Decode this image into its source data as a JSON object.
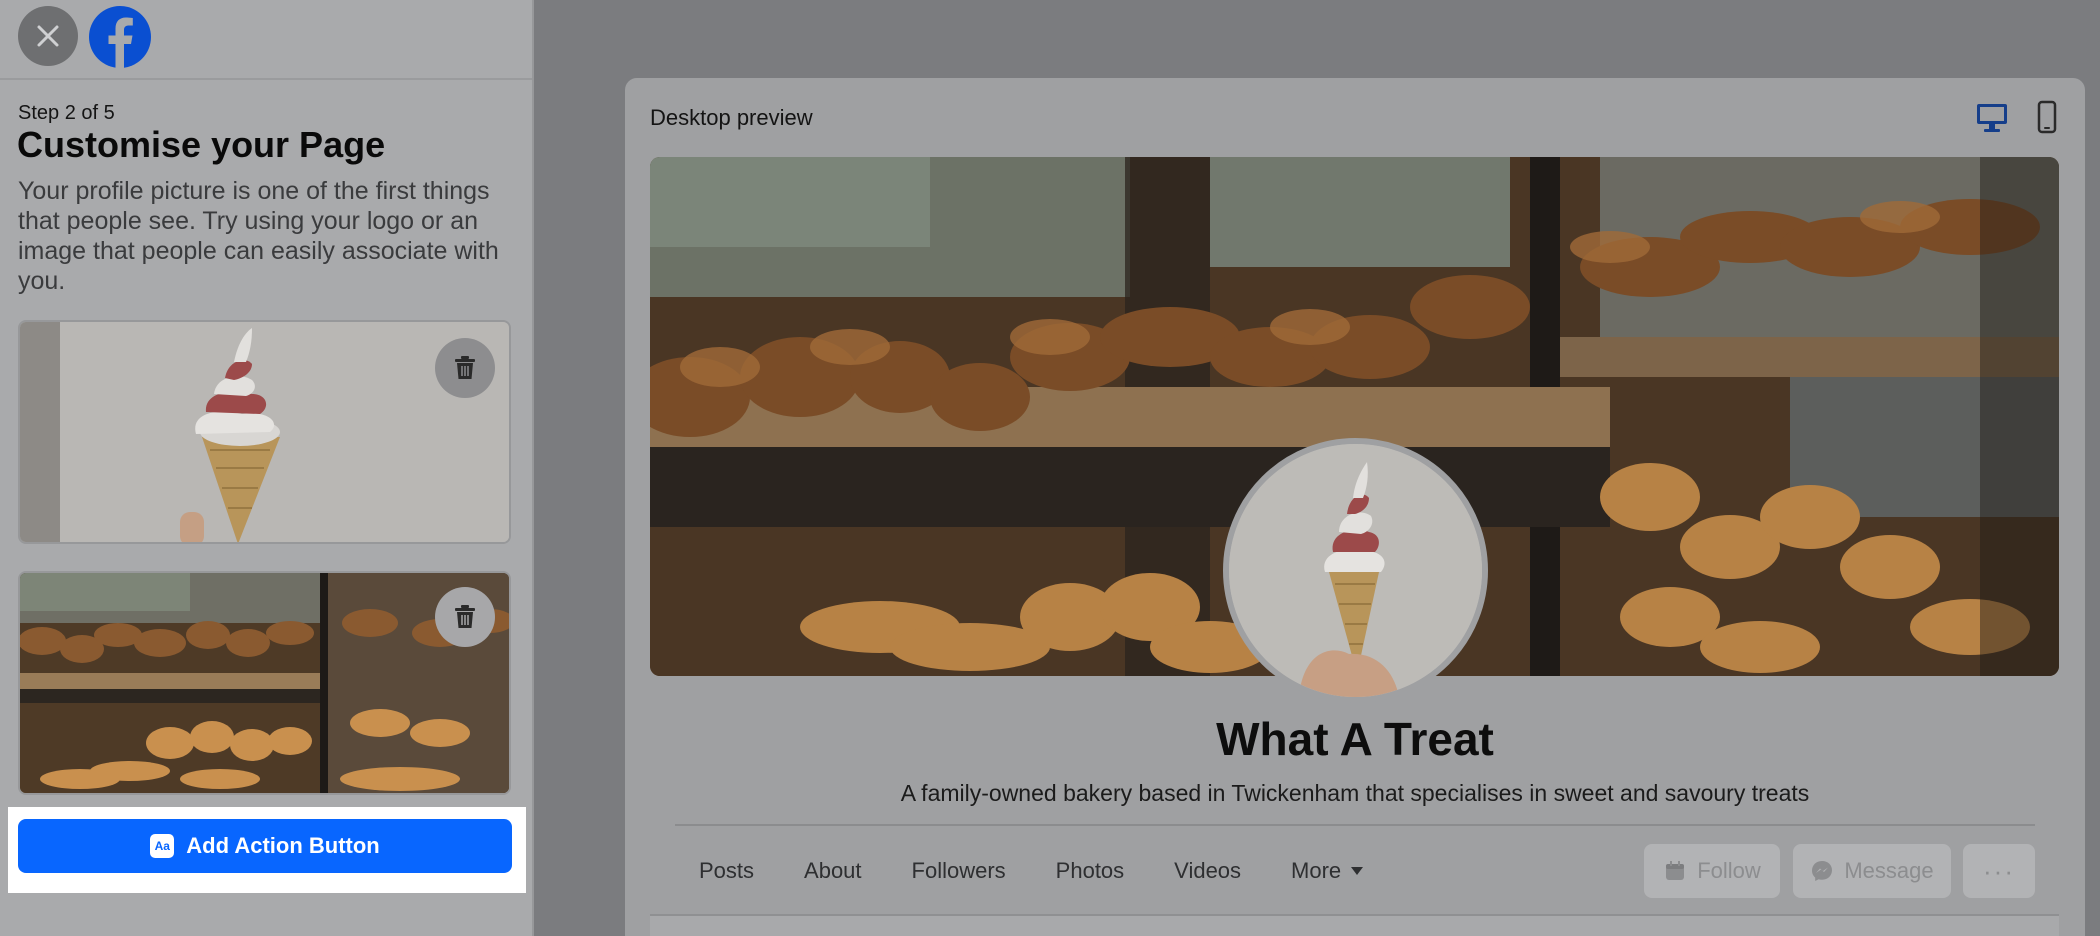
{
  "sidebar": {
    "step_label": "Step 2 of 5",
    "heading": "Customise your Page",
    "description": "Your profile picture is one of the first things that people see. Try using your logo or an image that people can easily associate with you.",
    "action_button_label": "Add Action Button",
    "action_button_icon_text": "Aa"
  },
  "preview": {
    "title": "Desktop preview",
    "page_name": "What A Treat",
    "page_description": "A family-owned bakery based in Twickenham that specialises in sweet and savoury treats",
    "tabs": [
      "Posts",
      "About",
      "Followers",
      "Photos",
      "Videos",
      "More"
    ],
    "buttons": {
      "follow": "Follow",
      "message": "Message",
      "more": "···"
    }
  },
  "colors": {
    "primary_blue": "#0866ff",
    "facebook_blue": "#0866ff"
  },
  "icons": [
    "close-icon",
    "facebook-logo",
    "trash-icon",
    "desktop-icon",
    "mobile-icon",
    "caret-down-icon",
    "follow-icon",
    "messenger-icon"
  ]
}
